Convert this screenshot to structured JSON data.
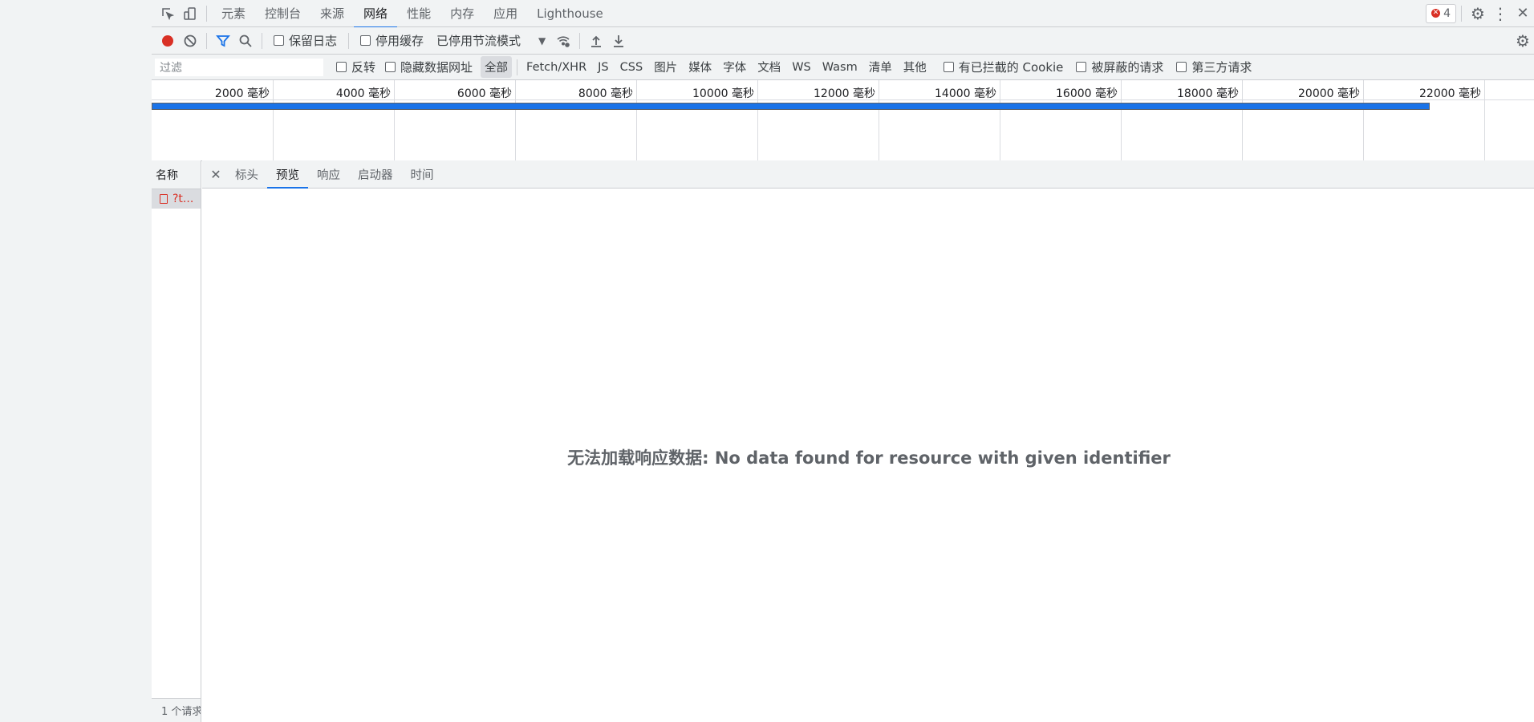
{
  "tabbar": {
    "tabs": [
      "元素",
      "控制台",
      "来源",
      "网络",
      "性能",
      "内存",
      "应用",
      "Lighthouse"
    ],
    "active_tab": "网络",
    "error_count": "4"
  },
  "toolbar": {
    "preserve_log": "保留日志",
    "disable_cache": "停用缓存",
    "throttling": "已停用节流模式"
  },
  "filterbar": {
    "filter_placeholder": "过滤",
    "invert": "反转",
    "hide_data_urls": "隐藏数据网址",
    "types": [
      "全部",
      "Fetch/XHR",
      "JS",
      "CSS",
      "图片",
      "媒体",
      "字体",
      "文档",
      "WS",
      "Wasm",
      "清单",
      "其他"
    ],
    "active_type": "全部",
    "blocked_cookies": "有已拦截的 Cookie",
    "blocked_requests": "被屏蔽的请求",
    "third_party": "第三方请求"
  },
  "timeline": {
    "ticks": [
      "2000 毫秒",
      "4000 毫秒",
      "6000 毫秒",
      "8000 毫秒",
      "10000 毫秒",
      "12000 毫秒",
      "14000 毫秒",
      "16000 毫秒",
      "18000 毫秒",
      "20000 毫秒",
      "22000 毫秒"
    ],
    "request_end_ms": 21100
  },
  "requests": {
    "column_name": "名称",
    "items": [
      {
        "name": "?t..."
      }
    ],
    "status_summary": "1 个请求"
  },
  "detail": {
    "tabs": [
      "标头",
      "预览",
      "响应",
      "启动器",
      "时间"
    ],
    "active_tab": "预览",
    "message": "无法加载响应数据: No data found for resource with given identifier"
  },
  "colors": {
    "accent": "#1a73e8",
    "record": "#d93025",
    "error": "#d93025"
  }
}
